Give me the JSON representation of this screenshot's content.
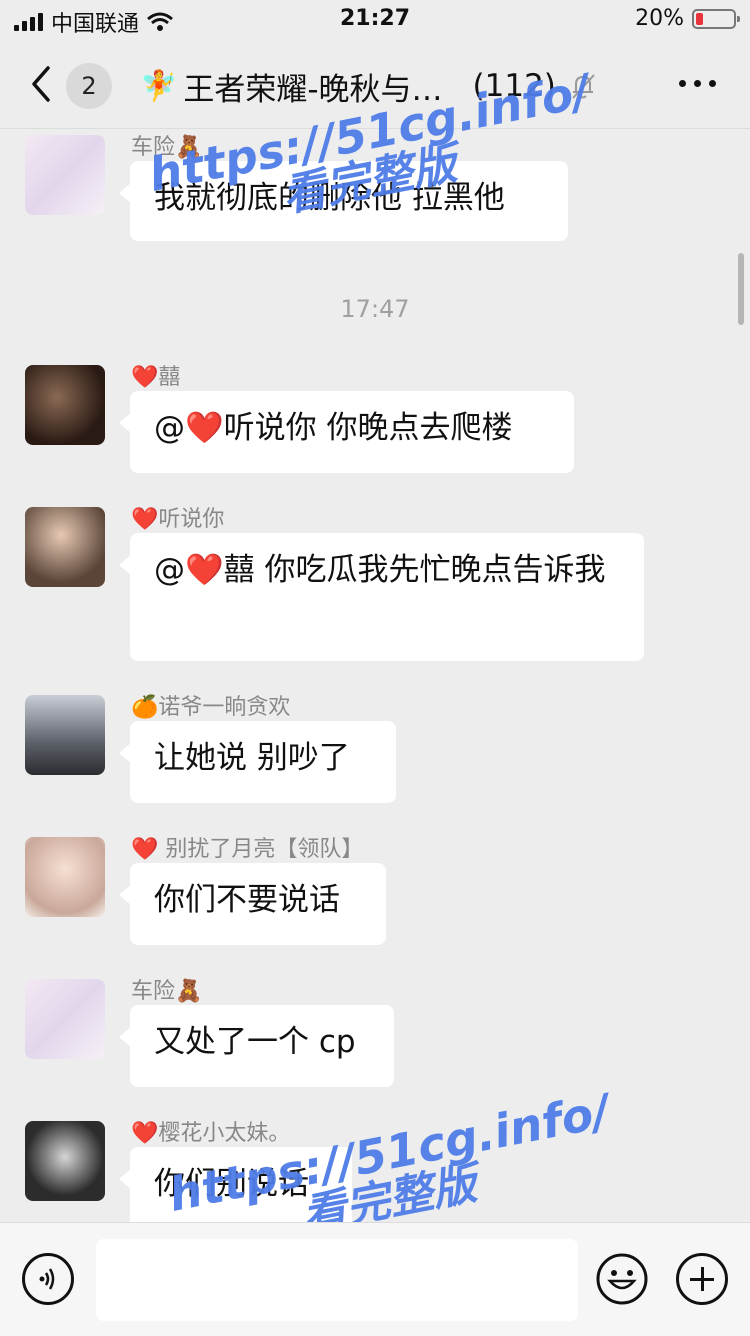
{
  "status_bar": {
    "carrier": "中国联通",
    "time": "21:27",
    "battery": "20%",
    "battery_level": 0.2,
    "battery_color": "#e8333a"
  },
  "nav": {
    "unread_count": "2",
    "title": "王者荣耀-晚秋与…",
    "member_count": "(112)",
    "title_icon": "fairy-emoji",
    "icons": [
      "back-chevron-icon",
      "mute-bell-icon",
      "more-dots-icon"
    ]
  },
  "messages": [
    {
      "sender": "车险🧸",
      "text": "我就彻底的删除他 拉黑他",
      "avatar": "anime-girl-avatar"
    },
    {
      "timestamp": "17:47"
    },
    {
      "sender": "❤️囍",
      "text": "@❤️听说你 你晚点去爬楼",
      "avatar": "woman-night-avatar"
    },
    {
      "sender": "❤️听说你",
      "text": "@❤️囍 你吃瓜我先忙晚点告诉我",
      "avatar": "woman-portrait-avatar"
    },
    {
      "sender": "🍊诺爷一晌贪欢",
      "text": "让她说 别吵了",
      "avatar": "man-silhouette-avatar"
    },
    {
      "sender": "❤️ 别扰了月亮【领队】",
      "text": "你们不要说话",
      "avatar": "woman-bright-avatar"
    },
    {
      "sender": "车险🧸",
      "text": "又处了一个 cp",
      "avatar": "anime-girl-avatar"
    },
    {
      "sender": "❤️樱花小太妹。",
      "text": "你们别说话",
      "avatar": "bw-woman-avatar"
    }
  ],
  "watermark": {
    "url": "https://51cg.info/",
    "caption": "看完整版",
    "color": "#4f7de8"
  },
  "input_bar": {
    "placeholder": "",
    "icons": [
      "voice-icon",
      "emoji-icon",
      "plus-icon"
    ]
  }
}
